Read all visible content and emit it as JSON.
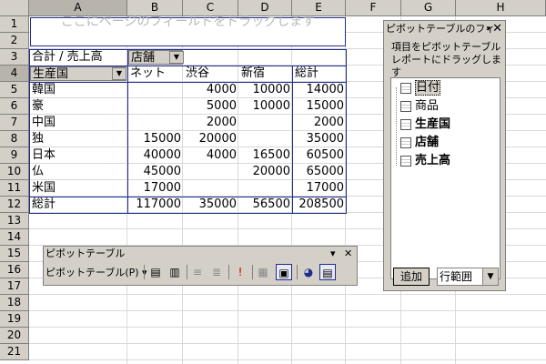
{
  "columns": [
    "A",
    "B",
    "C",
    "D",
    "E",
    "F",
    "G",
    "H"
  ],
  "rows": [
    "1",
    "2",
    "3",
    "4",
    "5",
    "6",
    "7",
    "8",
    "9",
    "10",
    "11",
    "12",
    "13",
    "14",
    "15",
    "16",
    "17",
    "18",
    "19",
    "20",
    "21"
  ],
  "page_drop_text": "ここにページのフィールドをドラッグします",
  "pivot": {
    "data_label": "合計 / 売上高",
    "col_field": "店舗",
    "row_field": "生産国",
    "col_headers": [
      "ネット",
      "渋谷",
      "新宿",
      "総計"
    ],
    "rows": [
      {
        "label": "韓国",
        "cells": [
          "",
          "4000",
          "10000",
          "14000"
        ]
      },
      {
        "label": "豪",
        "cells": [
          "",
          "5000",
          "10000",
          "15000"
        ]
      },
      {
        "label": "中国",
        "cells": [
          "",
          "2000",
          "",
          "2000"
        ]
      },
      {
        "label": "独",
        "cells": [
          "15000",
          "20000",
          "",
          "35000"
        ]
      },
      {
        "label": "日本",
        "cells": [
          "40000",
          "4000",
          "16500",
          "60500"
        ]
      },
      {
        "label": "仏",
        "cells": [
          "45000",
          "",
          "20000",
          "65000"
        ]
      },
      {
        "label": "米国",
        "cells": [
          "17000",
          "",
          "",
          "17000"
        ]
      },
      {
        "label": "総計",
        "cells": [
          "117000",
          "35000",
          "56500",
          "208500"
        ]
      }
    ]
  },
  "field_list": {
    "title": "ピボットテーブルのフィ",
    "description": "項目をピボットテーブル レポートにドラッグします",
    "fields": [
      "日付",
      "商品",
      "生産国",
      "店舗",
      "売上高"
    ],
    "add_button": "追加",
    "area_select": "行範囲"
  },
  "toolbar": {
    "title": "ピボットテーブル",
    "menu": "ピボットテーブル(P)"
  }
}
